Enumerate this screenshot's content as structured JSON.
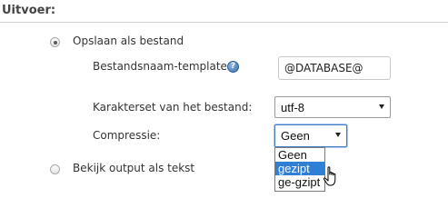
{
  "section": {
    "legend": "Uitvoer:"
  },
  "save_as_file": {
    "label": "Opslaan als bestand",
    "selected": true
  },
  "filename_template": {
    "label": "Bestandsnaam-template:",
    "value": "@DATABASE@",
    "help_icon": "help-icon"
  },
  "charset": {
    "label": "Karakterset van het bestand:",
    "value": "utf-8"
  },
  "compression": {
    "label": "Compressie:",
    "value": "Geen",
    "options": [
      "Geen",
      "gezipt",
      "ge-gzipt"
    ],
    "highlighted_option": "gezipt"
  },
  "view_as_text": {
    "label": "Bekijk output als tekst",
    "selected": false
  },
  "colors": {
    "highlight": "#2f7fd6",
    "focus_border": "#4a7ec9"
  }
}
